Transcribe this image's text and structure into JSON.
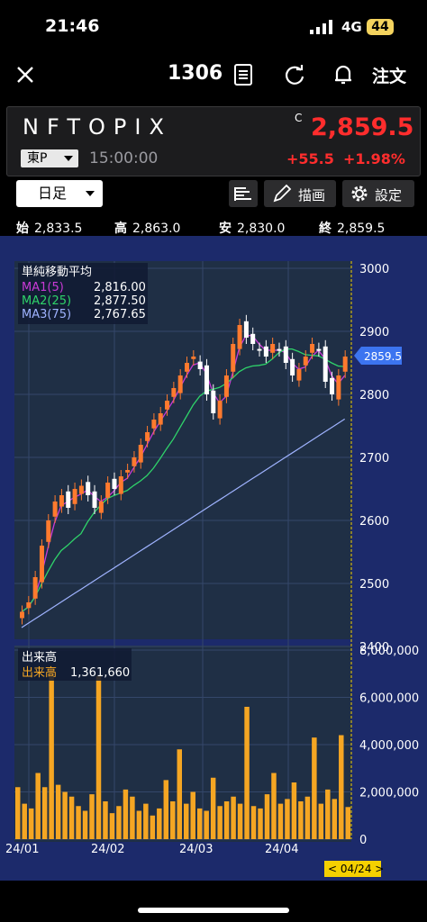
{
  "status_bar": {
    "time": "21:46",
    "network": "4G",
    "battery": "44"
  },
  "nav": {
    "code": "1306",
    "order_label": "注文"
  },
  "quote": {
    "name": "NFTOPIX",
    "c_mark": "C",
    "price": "2,859.5",
    "market": "東P",
    "time": "15:00:00",
    "change": "+55.5",
    "change_pct": "+1.98%",
    "accent_up": "#ff2d2d"
  },
  "controls": {
    "period": "日足",
    "draw_label": "描画",
    "settings_label": "設定"
  },
  "ohlc": [
    {
      "label": "始",
      "value": "2,833.5"
    },
    {
      "label": "高",
      "value": "2,863.0"
    },
    {
      "label": "安",
      "value": "2,830.0"
    },
    {
      "label": "終",
      "value": "2,859.5"
    }
  ],
  "chart_data": [
    {
      "type": "line",
      "legend_title": "単純移動平均",
      "series": [
        {
          "name": "MA1(5)",
          "last": "2,816.00",
          "color": "#c93ad6"
        },
        {
          "name": "MA2(25)",
          "last": "2,877.50",
          "color": "#2fd36a"
        },
        {
          "name": "MA3(75)",
          "last": "2,767.65",
          "color": "#9fb3ff"
        }
      ],
      "y_ticks": [
        "3000",
        "2900",
        "2800",
        "2700",
        "2600",
        "2500",
        "2400"
      ],
      "ylim": [
        2400,
        3000
      ],
      "current_price_label": "2859.5",
      "x_ticks": [
        "24/01",
        "24/02",
        "24/03",
        "24/04"
      ],
      "cursor_date": "< 04/24 >"
    },
    {
      "type": "bar",
      "title": "出来高",
      "legend": {
        "name": "出来高",
        "value": "1,361,660"
      },
      "y_ticks": [
        "8,000,000",
        "6,000,000",
        "4,000,000",
        "2,000,000",
        "0"
      ],
      "ylim": [
        0,
        8000000
      ],
      "bar_color": "#f5a623"
    }
  ]
}
